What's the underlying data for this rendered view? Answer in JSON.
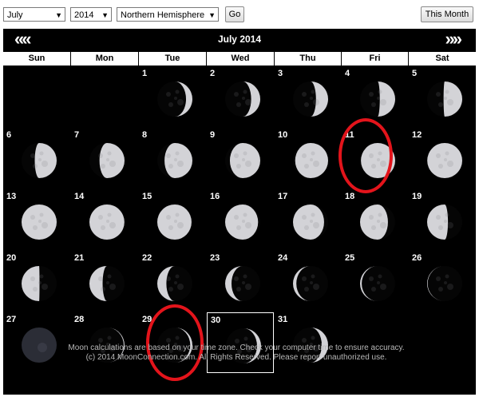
{
  "toolbar": {
    "month_value": "July",
    "year_value": "2014",
    "hemisphere_value": "Northern Hemisphere",
    "go_label": "Go",
    "this_month_label": "This Month"
  },
  "calendar": {
    "title": "July 2014",
    "prev_label": "«",
    "next_label": "»",
    "weekdays": [
      "Sun",
      "Mon",
      "Tue",
      "Wed",
      "Thu",
      "Fri",
      "Sat"
    ],
    "days": [
      {
        "day": "",
        "phase": null,
        "col": 0,
        "row": 0
      },
      {
        "day": "",
        "phase": null,
        "col": 1,
        "row": 0
      },
      {
        "day": "1",
        "phase": 0.14,
        "col": 2,
        "row": 0
      },
      {
        "day": "2",
        "phase": 0.17,
        "col": 3,
        "row": 0
      },
      {
        "day": "3",
        "phase": 0.2,
        "col": 4,
        "row": 0
      },
      {
        "day": "4",
        "phase": 0.23,
        "col": 5,
        "row": 0
      },
      {
        "day": "5",
        "phase": 0.26,
        "col": 6,
        "row": 0
      },
      {
        "day": "6",
        "phase": 0.29,
        "col": 0,
        "row": 1
      },
      {
        "day": "7",
        "phase": 0.32,
        "col": 1,
        "row": 1
      },
      {
        "day": "8",
        "phase": 0.35,
        "col": 2,
        "row": 1
      },
      {
        "day": "9",
        "phase": 0.38,
        "col": 3,
        "row": 1
      },
      {
        "day": "10",
        "phase": 0.42,
        "col": 4,
        "row": 1
      },
      {
        "day": "11",
        "phase": 0.45,
        "col": 5,
        "row": 1
      },
      {
        "day": "12",
        "phase": 0.48,
        "col": 6,
        "row": 1
      },
      {
        "day": "13",
        "phase": 0.5,
        "col": 0,
        "row": 2
      },
      {
        "day": "14",
        "phase": 0.52,
        "col": 1,
        "row": 2
      },
      {
        "day": "15",
        "phase": 0.55,
        "col": 2,
        "row": 2
      },
      {
        "day": "16",
        "phase": 0.58,
        "col": 3,
        "row": 2
      },
      {
        "day": "17",
        "phase": 0.61,
        "col": 4,
        "row": 2
      },
      {
        "day": "18",
        "phase": 0.65,
        "col": 5,
        "row": 2
      },
      {
        "day": "19",
        "phase": 0.72,
        "col": 6,
        "row": 2
      },
      {
        "day": "20",
        "phase": 0.75,
        "col": 0,
        "row": 3
      },
      {
        "day": "21",
        "phase": 0.79,
        "col": 1,
        "row": 3
      },
      {
        "day": "22",
        "phase": 0.83,
        "col": 2,
        "row": 3
      },
      {
        "day": "23",
        "phase": 0.86,
        "col": 3,
        "row": 3
      },
      {
        "day": "24",
        "phase": 0.9,
        "col": 4,
        "row": 3
      },
      {
        "day": "25",
        "phase": 0.93,
        "col": 5,
        "row": 3
      },
      {
        "day": "26",
        "phase": 0.96,
        "col": 6,
        "row": 3
      },
      {
        "day": "27",
        "phase": 0.0,
        "col": 0,
        "row": 4
      },
      {
        "day": "28",
        "phase": 0.05,
        "col": 1,
        "row": 4
      },
      {
        "day": "29",
        "phase": 0.08,
        "col": 2,
        "row": 4
      },
      {
        "day": "30",
        "phase": 0.11,
        "col": 3,
        "row": 4
      },
      {
        "day": "31",
        "phase": 0.14,
        "col": 4,
        "row": 4
      },
      {
        "day": "",
        "phase": null,
        "col": 5,
        "row": 4
      },
      {
        "day": "",
        "phase": null,
        "col": 6,
        "row": 4
      }
    ],
    "selected_day": "30",
    "circled_days": [
      "11",
      "29"
    ]
  },
  "footer": {
    "line1": "Moon calculations are based on your time zone. Check your computer time to ensure accuracy.",
    "line2": "(c) 2014 MoonConnection.com. All Rights Reserved. Please report unauthorized use."
  },
  "colors": {
    "highlight_circle": "#e3141b",
    "calendar_bg": "#000000"
  }
}
